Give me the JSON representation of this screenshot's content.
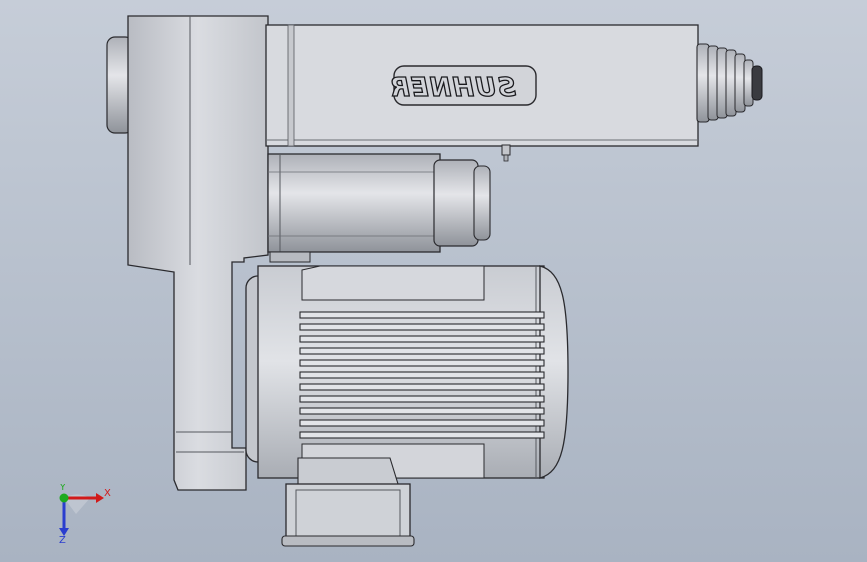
{
  "viewport": {
    "model_brand_text": "SUHNER"
  },
  "triad": {
    "x_label": "X",
    "y_label": "Y",
    "z_label": "Z"
  },
  "colors": {
    "background_top": "#c6cdd8",
    "background_bottom": "#a9b3c2",
    "model_fill": "#d4d6db",
    "model_shadow": "#9ea2a9",
    "edge": "#2a2a2e",
    "x_axis": "#d11a1a",
    "y_axis": "#1faa1f",
    "z_axis": "#2a3dcf"
  }
}
